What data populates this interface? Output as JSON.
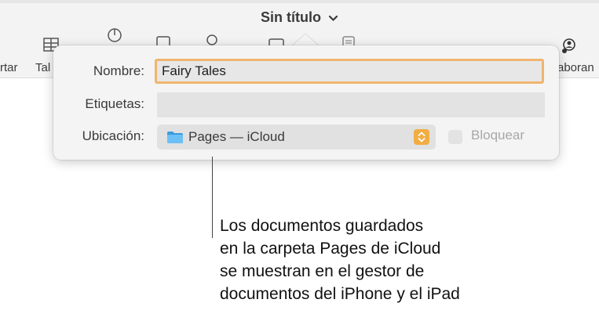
{
  "window": {
    "title": "Sin título"
  },
  "toolbar": {
    "labels": {
      "left_partial": "rtar",
      "table_partial": "Tal",
      "collaborate_partial": "aboran"
    },
    "icons": [
      "table-icon",
      "chart-icon",
      "text-icon",
      "shape-icon",
      "media-icon",
      "comment-icon",
      "collaborate-icon"
    ]
  },
  "save_dialog": {
    "name_label": "Nombre:",
    "name_value": "Fairy Tales",
    "tags_label": "Etiquetas:",
    "tags_value": "",
    "location_label": "Ubicación:",
    "location_value": "Pages — iCloud",
    "lock_label": "Bloquear",
    "accent_color": "#f2ad42",
    "focus_color": "#f0b56f"
  },
  "callout": {
    "lines": [
      "Los documentos guardados",
      "en la carpeta Pages de iCloud",
      "se muestran en el gestor de",
      "documentos del iPhone y el iPad"
    ]
  }
}
